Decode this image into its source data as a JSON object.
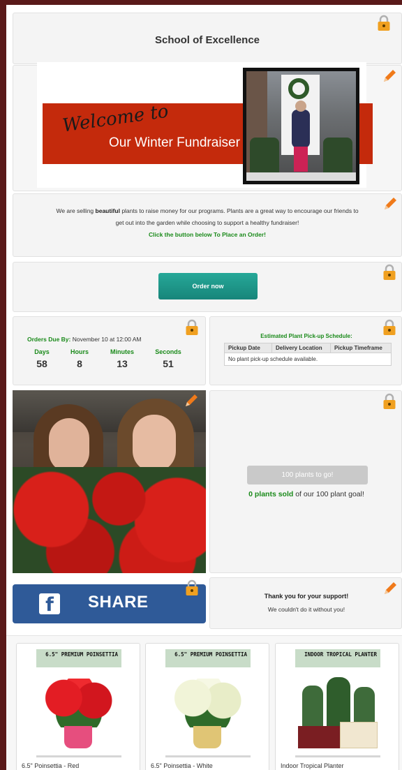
{
  "header": {
    "title": "School of Excellence"
  },
  "banner": {
    "script": "Welcome to",
    "main": "Our Winter Fundraiser"
  },
  "intro": {
    "pre": "We are selling ",
    "bold": "beautiful",
    "post1": " plants to raise money for our programs. Plants are a great way to encourage our friends to",
    "line2": "get out into the garden while choosing to support a healthy fundraiser!",
    "cta": "Click the button below To Place an Order!"
  },
  "order": {
    "button": "Order now"
  },
  "countdown": {
    "due_label": "Orders Due By:",
    "due_value": "November 10 at 12:00 AM",
    "labels": [
      "Days",
      "Hours",
      "Minutes",
      "Seconds"
    ],
    "values": [
      "58",
      "8",
      "13",
      "51"
    ]
  },
  "schedule": {
    "title": "Estimated Plant Pick-up Schedule:",
    "columns": [
      "Pickup Date",
      "Delivery Location",
      "Pickup Timeframe"
    ],
    "empty": "No plant pick-up schedule available."
  },
  "progress": {
    "pill": "100 plants to go!",
    "sold_bold": "0 plants sold",
    "sold_rest": " of our 100 plant goal!",
    "fraction": 0
  },
  "share": {
    "label": "SHARE",
    "icon": "facebook-icon"
  },
  "thanks": {
    "line1": "Thank you for your support!",
    "line2": "We couldn't do it without you!"
  },
  "products": [
    {
      "tag": "6.5\" PREMIUM POINSETTIA",
      "name": "6.5\" Poinsettia - Red"
    },
    {
      "tag": "6.5\" PREMIUM POINSETTIA",
      "name": "6.5\" Poinsettia - White"
    },
    {
      "tag": "INDOOR TROPICAL PLANTER",
      "name": "Indoor Tropical Planter"
    }
  ],
  "colors": {
    "accent_green": "#1a8a1a",
    "button_teal": "#1f9a8c",
    "facebook_blue": "#2f5a98",
    "banner_red": "#c42a0c"
  }
}
